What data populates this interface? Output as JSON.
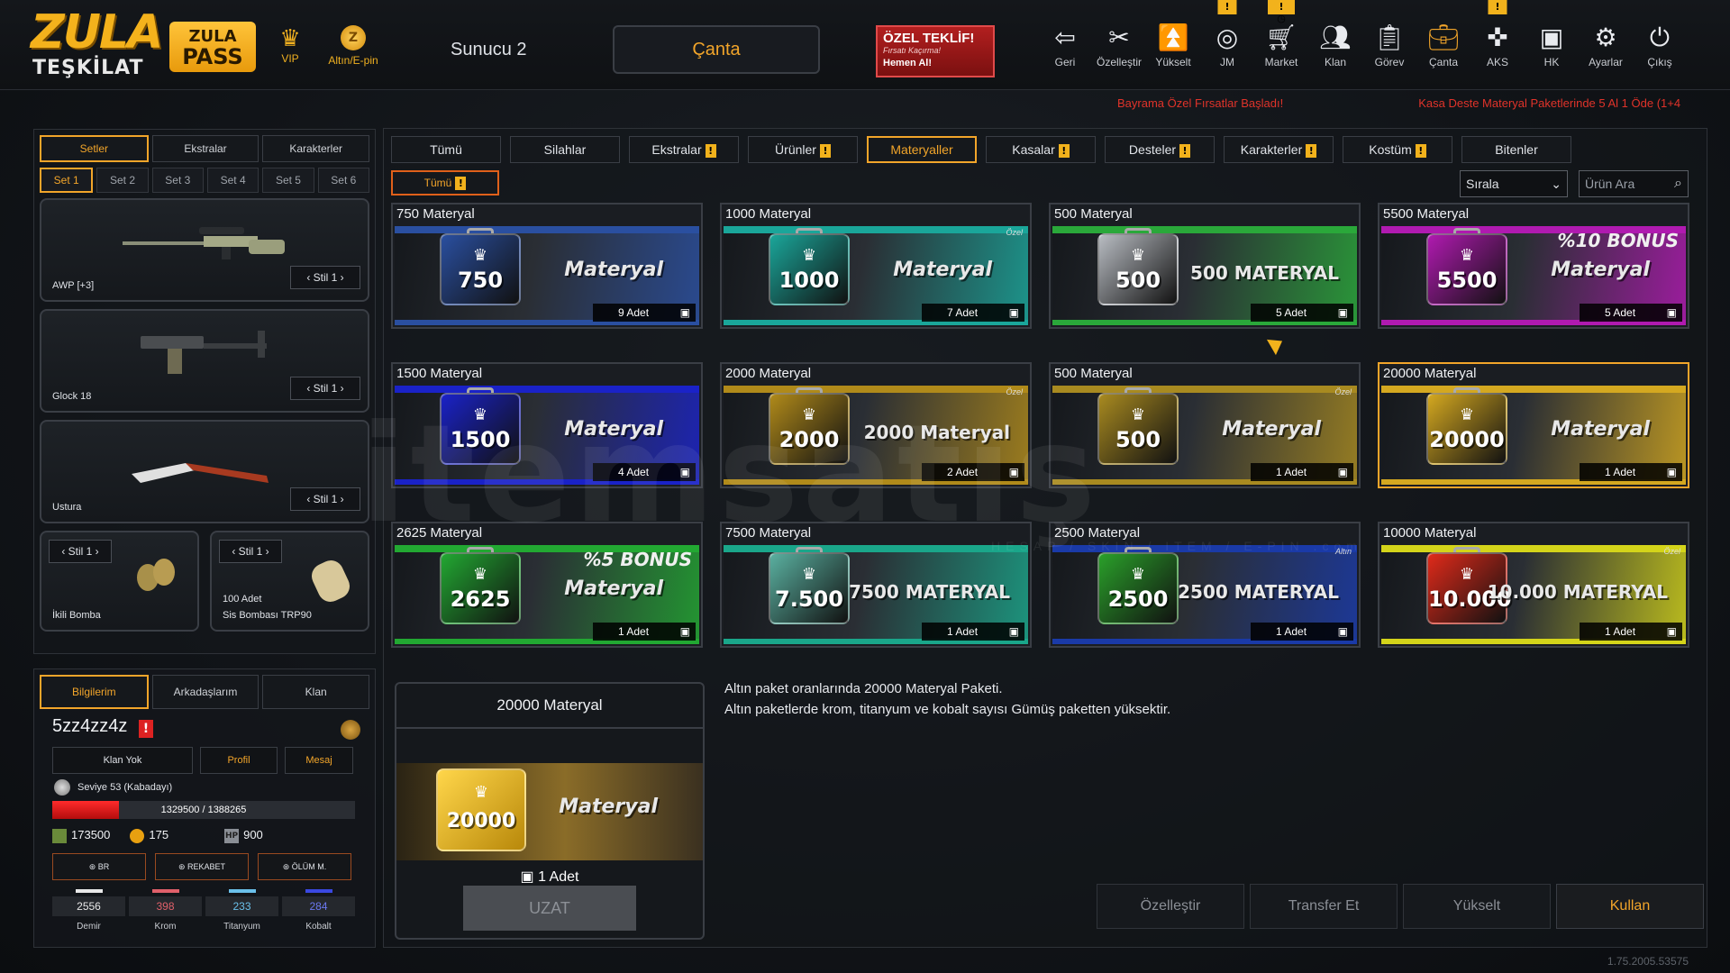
{
  "header": {
    "logo_line1": "ZULA",
    "logo_line2": "TEŞKİLAT",
    "pass_line1": "ZULA",
    "pass_line2": "PASS",
    "vip_label": "VIP",
    "altin_label": "Altın/E-pin",
    "server": "Sunucu 2",
    "active_tab": "Çanta",
    "offer_title": "ÖZEL TEKLİF!",
    "offer_sub": "Fırsatı Kaçırma!",
    "offer_cta": "Hemen Al!",
    "nav": [
      {
        "label": "Geri",
        "icon": "back-icon"
      },
      {
        "label": "Özelleştir",
        "icon": "tools-icon"
      },
      {
        "label": "Yükselt",
        "icon": "upgrade-icon"
      },
      {
        "label": "JM",
        "icon": "coins-icon",
        "badge": "!"
      },
      {
        "label": "Market",
        "icon": "cart-icon",
        "badge": "!◷"
      },
      {
        "label": "Klan",
        "icon": "clan-icon"
      },
      {
        "label": "Görev",
        "icon": "clipboard-icon"
      },
      {
        "label": "Çanta",
        "icon": "bag-icon"
      },
      {
        "label": "AKS",
        "icon": "crosshair-icon",
        "badge": "!"
      },
      {
        "label": "HK",
        "icon": "wallet-icon"
      },
      {
        "label": "Ayarlar",
        "icon": "gear-icon"
      },
      {
        "label": "Çıkış",
        "icon": "power-icon"
      }
    ],
    "ticker": [
      "Bayrama Özel Fırsatlar Başladı!",
      "Kasa Deste Materyal Paketlerinde 5 Al 1 Öde (1+4"
    ]
  },
  "left": {
    "tabs": [
      "Setler",
      "Ekstralar",
      "Karakterler"
    ],
    "sets": [
      "Set 1",
      "Set 2",
      "Set 3",
      "Set 4",
      "Set 5",
      "Set 6"
    ],
    "weapons": [
      {
        "name": "AWP [+3]",
        "stil": "Stil 1"
      },
      {
        "name": "Glock 18",
        "stil": "Stil 1"
      },
      {
        "name": "Ustura",
        "stil": "Stil 1"
      }
    ],
    "grenades": [
      {
        "name": "İkili Bomba",
        "stil": "Stil 1",
        "count": ""
      },
      {
        "name": "Sis Bombası TRP90",
        "stil": "Stil 1",
        "count": "100 Adet"
      }
    ]
  },
  "profile": {
    "tabs": [
      "Bilgilerim",
      "Arkadaşlarım",
      "Klan"
    ],
    "username": "5zz4zz4z",
    "btn_clan": "Klan Yok",
    "btn_profile": "Profil",
    "btn_message": "Mesaj",
    "level": "Seviye 53 (Kabadayı)",
    "xp": "1329500 / 1388265",
    "xp_fraction": 0.22,
    "zula_points": "173500",
    "gold": "175",
    "hp": "900",
    "modes": [
      "BR",
      "REKABET",
      "ÖLÜM M."
    ],
    "materials": [
      {
        "name": "Demir",
        "value": "2556",
        "color": "#e8e8e8"
      },
      {
        "name": "Krom",
        "value": "398",
        "color": "#e0606a"
      },
      {
        "name": "Titanyum",
        "value": "233",
        "color": "#6ac0ea"
      },
      {
        "name": "Kobalt",
        "value": "284",
        "color": "#3a48e0"
      }
    ]
  },
  "main": {
    "categories": [
      {
        "label": "Tümü",
        "badge": false
      },
      {
        "label": "Silahlar",
        "badge": false
      },
      {
        "label": "Ekstralar",
        "badge": true
      },
      {
        "label": "Ürünler",
        "badge": true
      },
      {
        "label": "Materyaller",
        "badge": false,
        "active": true
      },
      {
        "label": "Kasalar",
        "badge": true
      },
      {
        "label": "Desteler",
        "badge": true
      },
      {
        "label": "Karakterler",
        "badge": true
      },
      {
        "label": "Kostüm",
        "badge": true
      },
      {
        "label": "Bitenler",
        "badge": false
      }
    ],
    "subfilter": "Tümü",
    "sort_label": "Sırala",
    "search_placeholder": "Ürün Ara",
    "cards": [
      {
        "title": "750 Materyal",
        "num": "750",
        "word": "Materyal",
        "qty": "9 Adet",
        "color": "#2a4fa0",
        "bonus": "",
        "tag": ""
      },
      {
        "title": "1000 Materyal",
        "num": "1000",
        "word": "Materyal",
        "qty": "7 Adet",
        "color": "#1aa69a",
        "bonus": "",
        "tag": "Özel"
      },
      {
        "title": "500 Materyal",
        "num": "500",
        "word": "500 MATERYAL",
        "qty": "5 Adet",
        "color": "#b8bcc2",
        "bonus": "",
        "tag": "",
        "stripe": "#2aa83a"
      },
      {
        "title": "5500 Materyal",
        "num": "5500",
        "word": "Materyal",
        "qty": "5 Adet",
        "color": "#b01ab0",
        "bonus": "%10 BONUS",
        "tag": ""
      },
      {
        "title": "1500 Materyal",
        "num": "1500",
        "word": "Materyal",
        "qty": "4 Adet",
        "color": "#1a22c8",
        "bonus": "",
        "tag": ""
      },
      {
        "title": "2000 Materyal",
        "num": "2000",
        "word": "2000 Materyal",
        "qty": "2 Adet",
        "color": "#b08a1a",
        "bonus": "",
        "tag": "Özel"
      },
      {
        "title": "500 Materyal",
        "num": "500",
        "word": "Materyal",
        "qty": "1 Adet",
        "color": "#a88a20",
        "bonus": "",
        "tag": "Özel"
      },
      {
        "title": "20000 Materyal",
        "num": "20000",
        "word": "Materyal",
        "qty": "1 Adet",
        "color": "#d4a820",
        "bonus": "",
        "tag": "",
        "selected": true
      },
      {
        "title": "2625 Materyal",
        "num": "2625",
        "word": "Materyal",
        "qty": "1 Adet",
        "color": "#22a832",
        "bonus": "%5 BONUS",
        "tag": ""
      },
      {
        "title": "7500 Materyal",
        "num": "7.500",
        "word": "7500 MATERYAL",
        "qty": "1 Adet",
        "color": "#5ab0a0",
        "bonus": "",
        "tag": "",
        "stripe": "#1aa68a"
      },
      {
        "title": "2500 Materyal",
        "num": "2500",
        "word": "2500 MATERYAL",
        "qty": "1 Adet",
        "color": "#2aa02a",
        "bonus": "",
        "tag": "Altın",
        "stripe": "#1a3aa8"
      },
      {
        "title": "10000 Materyal",
        "num": "10.000",
        "word": "10.000 MATERYAL",
        "qty": "1 Adet",
        "color": "#e02a1a",
        "bonus": "",
        "tag": "Özel",
        "stripe": "#d4d41a"
      }
    ],
    "detail": {
      "title": "20000 Materyal",
      "num": "20000",
      "word": "Materyal",
      "qty": "1 Adet",
      "extend": "UZAT"
    },
    "description": [
      "Altın paket oranlarında 20000 Materyal Paketi.",
      "Altın paketlerde krom, titanyum ve kobalt sayısı Gümüş paketten yüksektir."
    ],
    "actions": [
      "Özelleştir",
      "Transfer Et",
      "Yükselt",
      "Kullan"
    ]
  },
  "version": "1.75.2005.53575",
  "watermark": "itemsatış",
  "watermark_sub": "HESAP / SKIN / ITEM / E-PIN .com"
}
